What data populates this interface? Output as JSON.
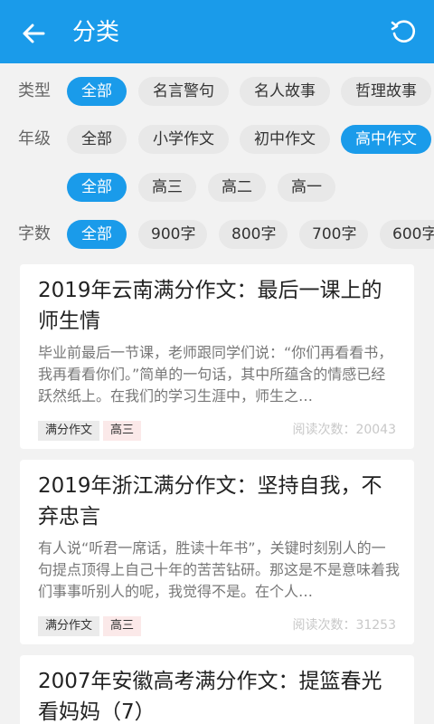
{
  "appbar": {
    "title": "分类"
  },
  "filters": {
    "type_label": "类型",
    "type_options": [
      "全部",
      "名言警句",
      "名人故事",
      "哲理故事"
    ],
    "grade_label": "年级",
    "grade_options": [
      "全部",
      "小学作文",
      "初中作文",
      "高中作文"
    ],
    "subgrade_options": [
      "全部",
      "高三",
      "高二",
      "高一"
    ],
    "words_label": "字数",
    "words_options": [
      "全部",
      "900字",
      "800字",
      "700字",
      "600字"
    ]
  },
  "articles": [
    {
      "title": "2019年云南满分作文：最后一课上的师生情",
      "excerpt": "毕业前最后一节课，老师跟同学们说：“你们再看看书，我再看看你们。”简单的一句话，其中所蕴含的情感已经跃然纸上。在我们的学习生涯中，师生之…",
      "tags": [
        "满分作文",
        "高三"
      ],
      "reads": "阅读次数：20043"
    },
    {
      "title": "2019年浙江满分作文：坚持自我，不弃忠言",
      "excerpt": "有人说“听君一席话，胜读十年书”，关键时刻别人的一句提点顶得上自己十年的苦苦钻研。那这是不是意味着我们事事听别人的呢，我觉得不是。在个人…",
      "tags": [
        "满分作文",
        "高三"
      ],
      "reads": "阅读次数：31253"
    },
    {
      "title": "2007年安徽高考满分作文：提篮春光看妈妈（7）"
    }
  ],
  "colors": {
    "primary": "#1a9bea",
    "chip_bg": "#e8e8e8",
    "tag_red_bg": "#fbe9e9"
  }
}
